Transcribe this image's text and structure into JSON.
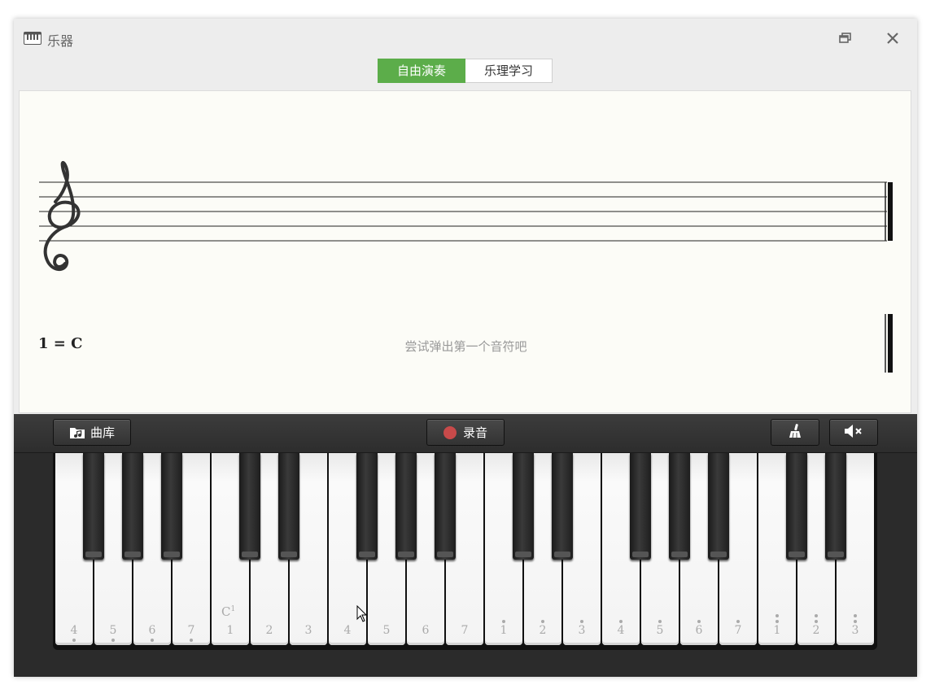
{
  "window": {
    "title": "乐器",
    "app_icon": "piano-keys-icon",
    "restore_icon": "restore-window-icon",
    "close_icon": "close-icon"
  },
  "tabs": [
    {
      "label": "自由演奏",
      "active": true
    },
    {
      "label": "乐理学习",
      "active": false
    }
  ],
  "score": {
    "clef_icon": "treble-clef-icon",
    "key_signature": "1 = C",
    "hint": "尝试弹出第一个音符吧"
  },
  "toolbar": {
    "library_label": "曲库",
    "library_icon": "music-folder-icon",
    "record_label": "录音",
    "record_icon": "record-dot-icon",
    "clean_icon": "broom-icon",
    "mute_icon": "speaker-mute-icon"
  },
  "keyboard": {
    "octave_marker": "C",
    "octave_marker_sup": "1",
    "white_keys": [
      {
        "label": "4",
        "dots_below": 1,
        "dots_above": 0
      },
      {
        "label": "5",
        "dots_below": 1,
        "dots_above": 0
      },
      {
        "label": "6",
        "dots_below": 1,
        "dots_above": 0
      },
      {
        "label": "7",
        "dots_below": 1,
        "dots_above": 0
      },
      {
        "label": "1",
        "dots_below": 0,
        "dots_above": 0
      },
      {
        "label": "2",
        "dots_below": 0,
        "dots_above": 0
      },
      {
        "label": "3",
        "dots_below": 0,
        "dots_above": 0
      },
      {
        "label": "4",
        "dots_below": 0,
        "dots_above": 0
      },
      {
        "label": "5",
        "dots_below": 0,
        "dots_above": 0
      },
      {
        "label": "6",
        "dots_below": 0,
        "dots_above": 0
      },
      {
        "label": "7",
        "dots_below": 0,
        "dots_above": 0
      },
      {
        "label": "1",
        "dots_below": 0,
        "dots_above": 1
      },
      {
        "label": "2",
        "dots_below": 0,
        "dots_above": 1
      },
      {
        "label": "3",
        "dots_below": 0,
        "dots_above": 1
      },
      {
        "label": "4",
        "dots_below": 0,
        "dots_above": 1
      },
      {
        "label": "5",
        "dots_below": 0,
        "dots_above": 1
      },
      {
        "label": "6",
        "dots_below": 0,
        "dots_above": 1
      },
      {
        "label": "7",
        "dots_below": 0,
        "dots_above": 1
      },
      {
        "label": "1",
        "dots_below": 0,
        "dots_above": 2
      },
      {
        "label": "2",
        "dots_below": 0,
        "dots_above": 2
      },
      {
        "label": "3",
        "dots_below": 0,
        "dots_above": 2
      }
    ]
  }
}
